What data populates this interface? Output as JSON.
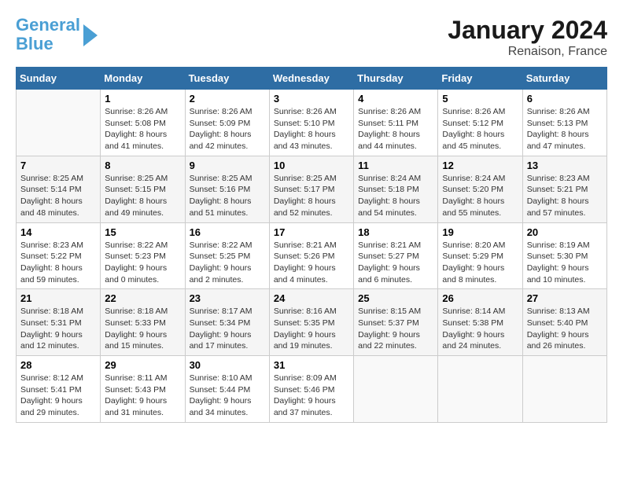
{
  "header": {
    "logo_line1": "General",
    "logo_line2": "Blue",
    "title": "January 2024",
    "subtitle": "Renaison, France"
  },
  "days_of_week": [
    "Sunday",
    "Monday",
    "Tuesday",
    "Wednesday",
    "Thursday",
    "Friday",
    "Saturday"
  ],
  "weeks": [
    [
      {
        "num": "",
        "sunrise": "",
        "sunset": "",
        "daylight": ""
      },
      {
        "num": "1",
        "sunrise": "Sunrise: 8:26 AM",
        "sunset": "Sunset: 5:08 PM",
        "daylight": "Daylight: 8 hours and 41 minutes."
      },
      {
        "num": "2",
        "sunrise": "Sunrise: 8:26 AM",
        "sunset": "Sunset: 5:09 PM",
        "daylight": "Daylight: 8 hours and 42 minutes."
      },
      {
        "num": "3",
        "sunrise": "Sunrise: 8:26 AM",
        "sunset": "Sunset: 5:10 PM",
        "daylight": "Daylight: 8 hours and 43 minutes."
      },
      {
        "num": "4",
        "sunrise": "Sunrise: 8:26 AM",
        "sunset": "Sunset: 5:11 PM",
        "daylight": "Daylight: 8 hours and 44 minutes."
      },
      {
        "num": "5",
        "sunrise": "Sunrise: 8:26 AM",
        "sunset": "Sunset: 5:12 PM",
        "daylight": "Daylight: 8 hours and 45 minutes."
      },
      {
        "num": "6",
        "sunrise": "Sunrise: 8:26 AM",
        "sunset": "Sunset: 5:13 PM",
        "daylight": "Daylight: 8 hours and 47 minutes."
      }
    ],
    [
      {
        "num": "7",
        "sunrise": "Sunrise: 8:25 AM",
        "sunset": "Sunset: 5:14 PM",
        "daylight": "Daylight: 8 hours and 48 minutes."
      },
      {
        "num": "8",
        "sunrise": "Sunrise: 8:25 AM",
        "sunset": "Sunset: 5:15 PM",
        "daylight": "Daylight: 8 hours and 49 minutes."
      },
      {
        "num": "9",
        "sunrise": "Sunrise: 8:25 AM",
        "sunset": "Sunset: 5:16 PM",
        "daylight": "Daylight: 8 hours and 51 minutes."
      },
      {
        "num": "10",
        "sunrise": "Sunrise: 8:25 AM",
        "sunset": "Sunset: 5:17 PM",
        "daylight": "Daylight: 8 hours and 52 minutes."
      },
      {
        "num": "11",
        "sunrise": "Sunrise: 8:24 AM",
        "sunset": "Sunset: 5:18 PM",
        "daylight": "Daylight: 8 hours and 54 minutes."
      },
      {
        "num": "12",
        "sunrise": "Sunrise: 8:24 AM",
        "sunset": "Sunset: 5:20 PM",
        "daylight": "Daylight: 8 hours and 55 minutes."
      },
      {
        "num": "13",
        "sunrise": "Sunrise: 8:23 AM",
        "sunset": "Sunset: 5:21 PM",
        "daylight": "Daylight: 8 hours and 57 minutes."
      }
    ],
    [
      {
        "num": "14",
        "sunrise": "Sunrise: 8:23 AM",
        "sunset": "Sunset: 5:22 PM",
        "daylight": "Daylight: 8 hours and 59 minutes."
      },
      {
        "num": "15",
        "sunrise": "Sunrise: 8:22 AM",
        "sunset": "Sunset: 5:23 PM",
        "daylight": "Daylight: 9 hours and 0 minutes."
      },
      {
        "num": "16",
        "sunrise": "Sunrise: 8:22 AM",
        "sunset": "Sunset: 5:25 PM",
        "daylight": "Daylight: 9 hours and 2 minutes."
      },
      {
        "num": "17",
        "sunrise": "Sunrise: 8:21 AM",
        "sunset": "Sunset: 5:26 PM",
        "daylight": "Daylight: 9 hours and 4 minutes."
      },
      {
        "num": "18",
        "sunrise": "Sunrise: 8:21 AM",
        "sunset": "Sunset: 5:27 PM",
        "daylight": "Daylight: 9 hours and 6 minutes."
      },
      {
        "num": "19",
        "sunrise": "Sunrise: 8:20 AM",
        "sunset": "Sunset: 5:29 PM",
        "daylight": "Daylight: 9 hours and 8 minutes."
      },
      {
        "num": "20",
        "sunrise": "Sunrise: 8:19 AM",
        "sunset": "Sunset: 5:30 PM",
        "daylight": "Daylight: 9 hours and 10 minutes."
      }
    ],
    [
      {
        "num": "21",
        "sunrise": "Sunrise: 8:18 AM",
        "sunset": "Sunset: 5:31 PM",
        "daylight": "Daylight: 9 hours and 12 minutes."
      },
      {
        "num": "22",
        "sunrise": "Sunrise: 8:18 AM",
        "sunset": "Sunset: 5:33 PM",
        "daylight": "Daylight: 9 hours and 15 minutes."
      },
      {
        "num": "23",
        "sunrise": "Sunrise: 8:17 AM",
        "sunset": "Sunset: 5:34 PM",
        "daylight": "Daylight: 9 hours and 17 minutes."
      },
      {
        "num": "24",
        "sunrise": "Sunrise: 8:16 AM",
        "sunset": "Sunset: 5:35 PM",
        "daylight": "Daylight: 9 hours and 19 minutes."
      },
      {
        "num": "25",
        "sunrise": "Sunrise: 8:15 AM",
        "sunset": "Sunset: 5:37 PM",
        "daylight": "Daylight: 9 hours and 22 minutes."
      },
      {
        "num": "26",
        "sunrise": "Sunrise: 8:14 AM",
        "sunset": "Sunset: 5:38 PM",
        "daylight": "Daylight: 9 hours and 24 minutes."
      },
      {
        "num": "27",
        "sunrise": "Sunrise: 8:13 AM",
        "sunset": "Sunset: 5:40 PM",
        "daylight": "Daylight: 9 hours and 26 minutes."
      }
    ],
    [
      {
        "num": "28",
        "sunrise": "Sunrise: 8:12 AM",
        "sunset": "Sunset: 5:41 PM",
        "daylight": "Daylight: 9 hours and 29 minutes."
      },
      {
        "num": "29",
        "sunrise": "Sunrise: 8:11 AM",
        "sunset": "Sunset: 5:43 PM",
        "daylight": "Daylight: 9 hours and 31 minutes."
      },
      {
        "num": "30",
        "sunrise": "Sunrise: 8:10 AM",
        "sunset": "Sunset: 5:44 PM",
        "daylight": "Daylight: 9 hours and 34 minutes."
      },
      {
        "num": "31",
        "sunrise": "Sunrise: 8:09 AM",
        "sunset": "Sunset: 5:46 PM",
        "daylight": "Daylight: 9 hours and 37 minutes."
      },
      {
        "num": "",
        "sunrise": "",
        "sunset": "",
        "daylight": ""
      },
      {
        "num": "",
        "sunrise": "",
        "sunset": "",
        "daylight": ""
      },
      {
        "num": "",
        "sunrise": "",
        "sunset": "",
        "daylight": ""
      }
    ]
  ]
}
